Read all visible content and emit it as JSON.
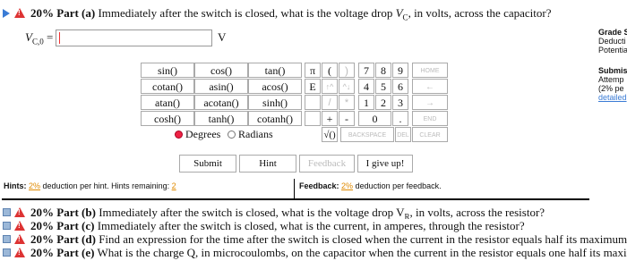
{
  "part_a": {
    "percent": "20%",
    "part": "Part (a)",
    "question_before": "Immediately after the switch is closed, what is the voltage drop",
    "symbol": "V",
    "symbol_sub": "C",
    "question_after": ", in volts, across the capacitor?"
  },
  "answer": {
    "label_main": "V",
    "label_sub": "C,0",
    "equals": " =",
    "value": "",
    "unit": "V"
  },
  "calculator": {
    "functions": [
      [
        "sin()",
        "cos()",
        "tan()"
      ],
      [
        "cotan()",
        "asin()",
        "acos()"
      ],
      [
        "atan()",
        "acotan()",
        "sinh()"
      ],
      [
        "cosh()",
        "tanh()",
        "cotanh()"
      ]
    ],
    "degrees_label": "Degrees",
    "radians_label": "Radians",
    "keys": {
      "pi": "π",
      "lparen": "(",
      "rparen": ")",
      "E": "E",
      "up": "↑^",
      "down": "^↓",
      "slash": "/",
      "star": "*",
      "plus": "+",
      "minus": "-",
      "sqrt": "√()",
      "backspace": "BACKSPACE",
      "del": "DEL",
      "clear": "CLEAR",
      "home": "HOME",
      "back": "←",
      "fwd": "→",
      "end": "END",
      "n7": "7",
      "n8": "8",
      "n9": "9",
      "n4": "4",
      "n5": "5",
      "n6": "6",
      "n1": "1",
      "n2": "2",
      "n3": "3",
      "n0": "0",
      "dot": "."
    }
  },
  "buttons": {
    "submit": "Submit",
    "hint": "Hint",
    "feedback": "Feedback",
    "give_up": "I give up!"
  },
  "hints": {
    "label": "Hints:",
    "pct": "2%",
    "text": "deduction per hint. Hints remaining:",
    "remaining": "2"
  },
  "feedback": {
    "label": "Feedback:",
    "pct": "2%",
    "text": "deduction per feedback."
  },
  "side": {
    "grade": "Grade S",
    "deduction": "Deducti",
    "potential": "Potentia",
    "submissions": "Submis",
    "attempts": "Attemp",
    "pct_line": "(2% pe",
    "detailed": "detailed"
  },
  "other_parts": [
    {
      "percent": "20%",
      "part": "Part (b)",
      "text": "Immediately after the switch is closed, what is the voltage drop V",
      "sub": "R",
      "rest": ", in volts, across the resistor?"
    },
    {
      "percent": "20%",
      "part": "Part (c)",
      "text": "Immediately after the switch is closed, what is the current, in amperes, through the resistor?",
      "sub": "",
      "rest": ""
    },
    {
      "percent": "20%",
      "part": "Part (d)",
      "text": "Find an expression for the time after the switch is closed when the current in the resistor equals half its maximum value.",
      "sub": "",
      "rest": ""
    },
    {
      "percent": "20%",
      "part": "Part (e)",
      "text": "What is the charge Q, in microcoulombs, on the capacitor when the current in the resistor equals one half its maximum value",
      "sub": "",
      "rest": ""
    }
  ]
}
